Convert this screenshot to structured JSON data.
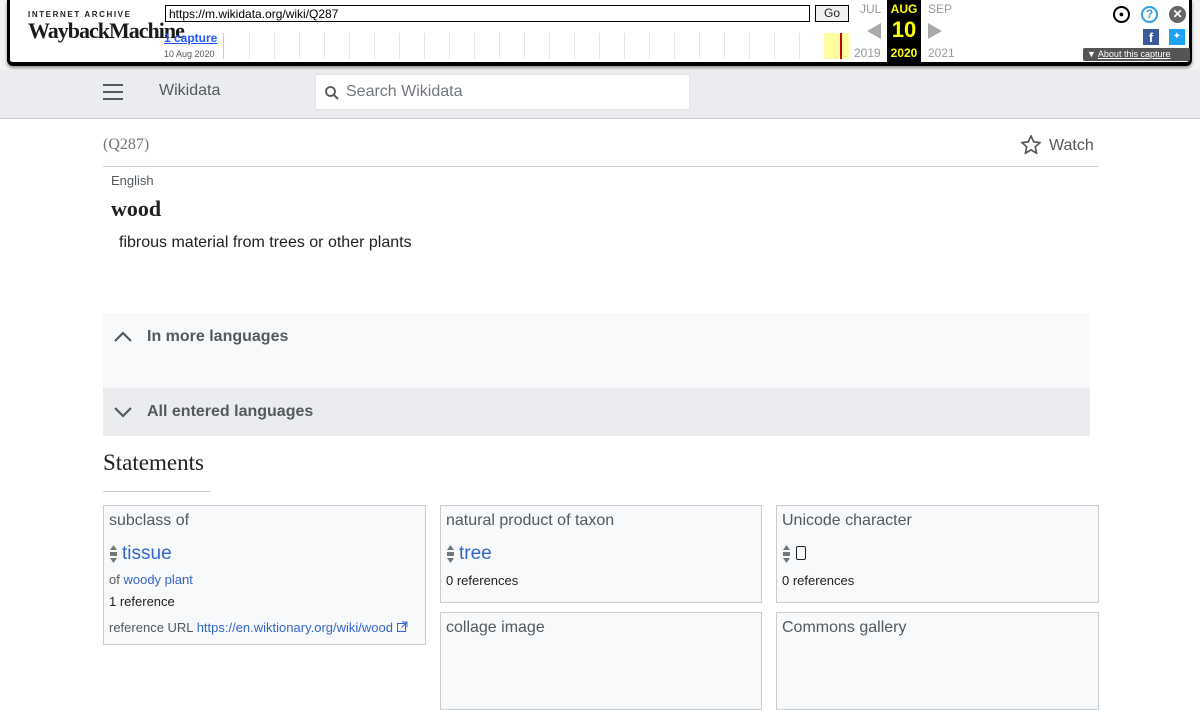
{
  "wayback": {
    "logo_top": "INTERNET ARCHIVE",
    "logo_main_a": "Wayback",
    "logo_main_b": "Machine",
    "url": "https://m.wikidata.org/wiki/Q287",
    "go_label": "Go",
    "captures_link": "1 capture",
    "capture_date": "10 Aug 2020",
    "prev_month": "JUL",
    "prev_year": "2019",
    "cur_month": "AUG",
    "cur_day": "10",
    "cur_year": "2020",
    "next_month": "SEP",
    "next_year": "2021",
    "about_label": "About this capture"
  },
  "header": {
    "site_name": "Wikidata",
    "search_placeholder": "Search Wikidata"
  },
  "item": {
    "qid": "(Q287)",
    "watch_label": "Watch",
    "language": "English",
    "label": "wood",
    "description": "fibrous material from trees or other plants"
  },
  "sections": {
    "more_languages": "In more languages",
    "all_languages": "All entered languages"
  },
  "statements": {
    "heading": "Statements",
    "cards": [
      {
        "property": "subclass of",
        "value": "tissue",
        "qualifier_prefix": "of",
        "qualifier_links": [
          "woody",
          "plant"
        ],
        "references": "1 reference",
        "ref_url_label": "reference URL",
        "ref_url": "https://en.wiktionary.org/wiki/wood"
      },
      {
        "property": "natural product of taxon",
        "value": "tree",
        "references": "0 references"
      },
      {
        "property": "Unicode character",
        "value": "",
        "references": "0 references"
      },
      {
        "property": "collage image"
      },
      {
        "property": "Commons gallery"
      }
    ]
  },
  "colors": {
    "link": "#3366cc",
    "header_bg": "#eaecf0",
    "wayback_highlight": "#ffff00"
  }
}
